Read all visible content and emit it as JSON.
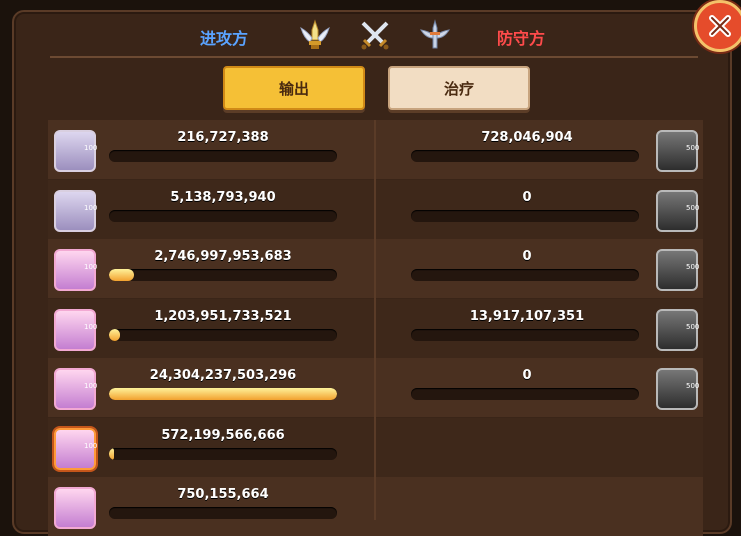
{
  "header": {
    "attacker_label": "进攻方",
    "defender_label": "防守方"
  },
  "tabs": {
    "output_label": "输出",
    "heal_label": "治疗"
  },
  "icons": {
    "header_left": "winged-sword-trophy-icon",
    "header_center": "crossed-swords-icon",
    "header_right": "winged-sword-emblem-icon",
    "close": "close-icon"
  },
  "colors": {
    "attacker": "#5aa3ff",
    "defender": "#ff4b4b",
    "bar_fill_top": "#fff29a",
    "bar_fill_bottom": "#f2a12f"
  },
  "rows": [
    {
      "left_value": "216,727,388",
      "left_fill": 0.0,
      "left_level": "100",
      "right_value": "728,046,904",
      "right_fill": 0.0,
      "right_level": "500"
    },
    {
      "left_value": "5,138,793,940",
      "left_fill": 0.0,
      "left_level": "100",
      "right_value": "0",
      "right_fill": 0.0,
      "right_level": "500"
    },
    {
      "left_value": "2,746,997,953,683",
      "left_fill": 0.11,
      "left_level": "100",
      "right_value": "0",
      "right_fill": 0.0,
      "right_level": "500"
    },
    {
      "left_value": "1,203,951,733,521",
      "left_fill": 0.05,
      "left_level": "100",
      "right_value": "13,917,107,351",
      "right_fill": 0.0,
      "right_level": "500"
    },
    {
      "left_value": "24,304,237,503,296",
      "left_fill": 1.0,
      "left_level": "100",
      "right_value": "0",
      "right_fill": 0.0,
      "right_level": "500"
    },
    {
      "left_value": "572,199,566,666",
      "left_fill": 0.02,
      "left_level": "100"
    },
    {
      "left_value": "750,155,664",
      "left_fill": 0.0,
      "left_level": ""
    }
  ]
}
